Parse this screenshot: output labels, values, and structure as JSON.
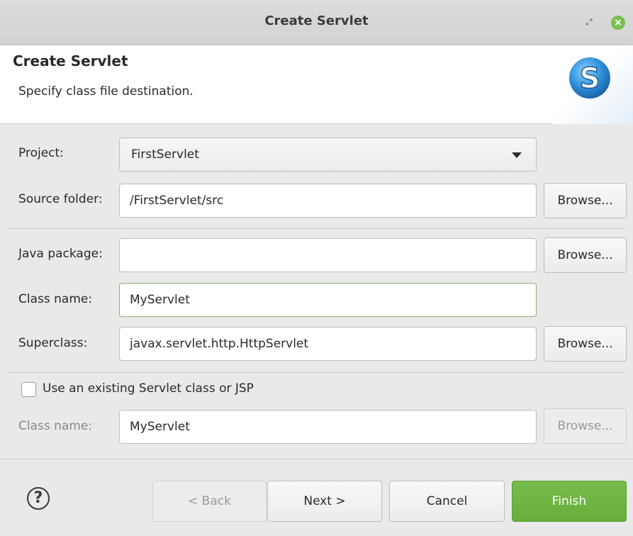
{
  "window": {
    "title": "Create Servlet"
  },
  "banner": {
    "title": "Create Servlet",
    "description": "Specify class file destination.",
    "icon": "servlet-s-icon",
    "icon_letter": "S",
    "icon_color": "#2d8fd8"
  },
  "form": {
    "project": {
      "label": "Project:",
      "value": "FirstServlet"
    },
    "source_folder": {
      "label": "Source folder:",
      "value": "/FirstServlet/src",
      "browse": "Browse..."
    },
    "java_package": {
      "label": "Java package:",
      "value": "",
      "browse": "Browse..."
    },
    "class_name": {
      "label": "Class name:",
      "value": "MyServlet"
    },
    "superclass": {
      "label": "Superclass:",
      "value": "javax.servlet.http.HttpServlet",
      "browse": "Browse..."
    },
    "use_existing": {
      "label": "Use an existing Servlet class or JSP",
      "checked": false
    },
    "existing_class": {
      "label": "Class name:",
      "value": "MyServlet",
      "browse": "Browse..."
    }
  },
  "footer": {
    "help": "?",
    "back": "< Back",
    "next": "Next >",
    "cancel": "Cancel",
    "finish": "Finish"
  },
  "colors": {
    "finish_button": "#6fb545",
    "focused_border": "#86b36a",
    "close_button": "#7bbf52"
  }
}
